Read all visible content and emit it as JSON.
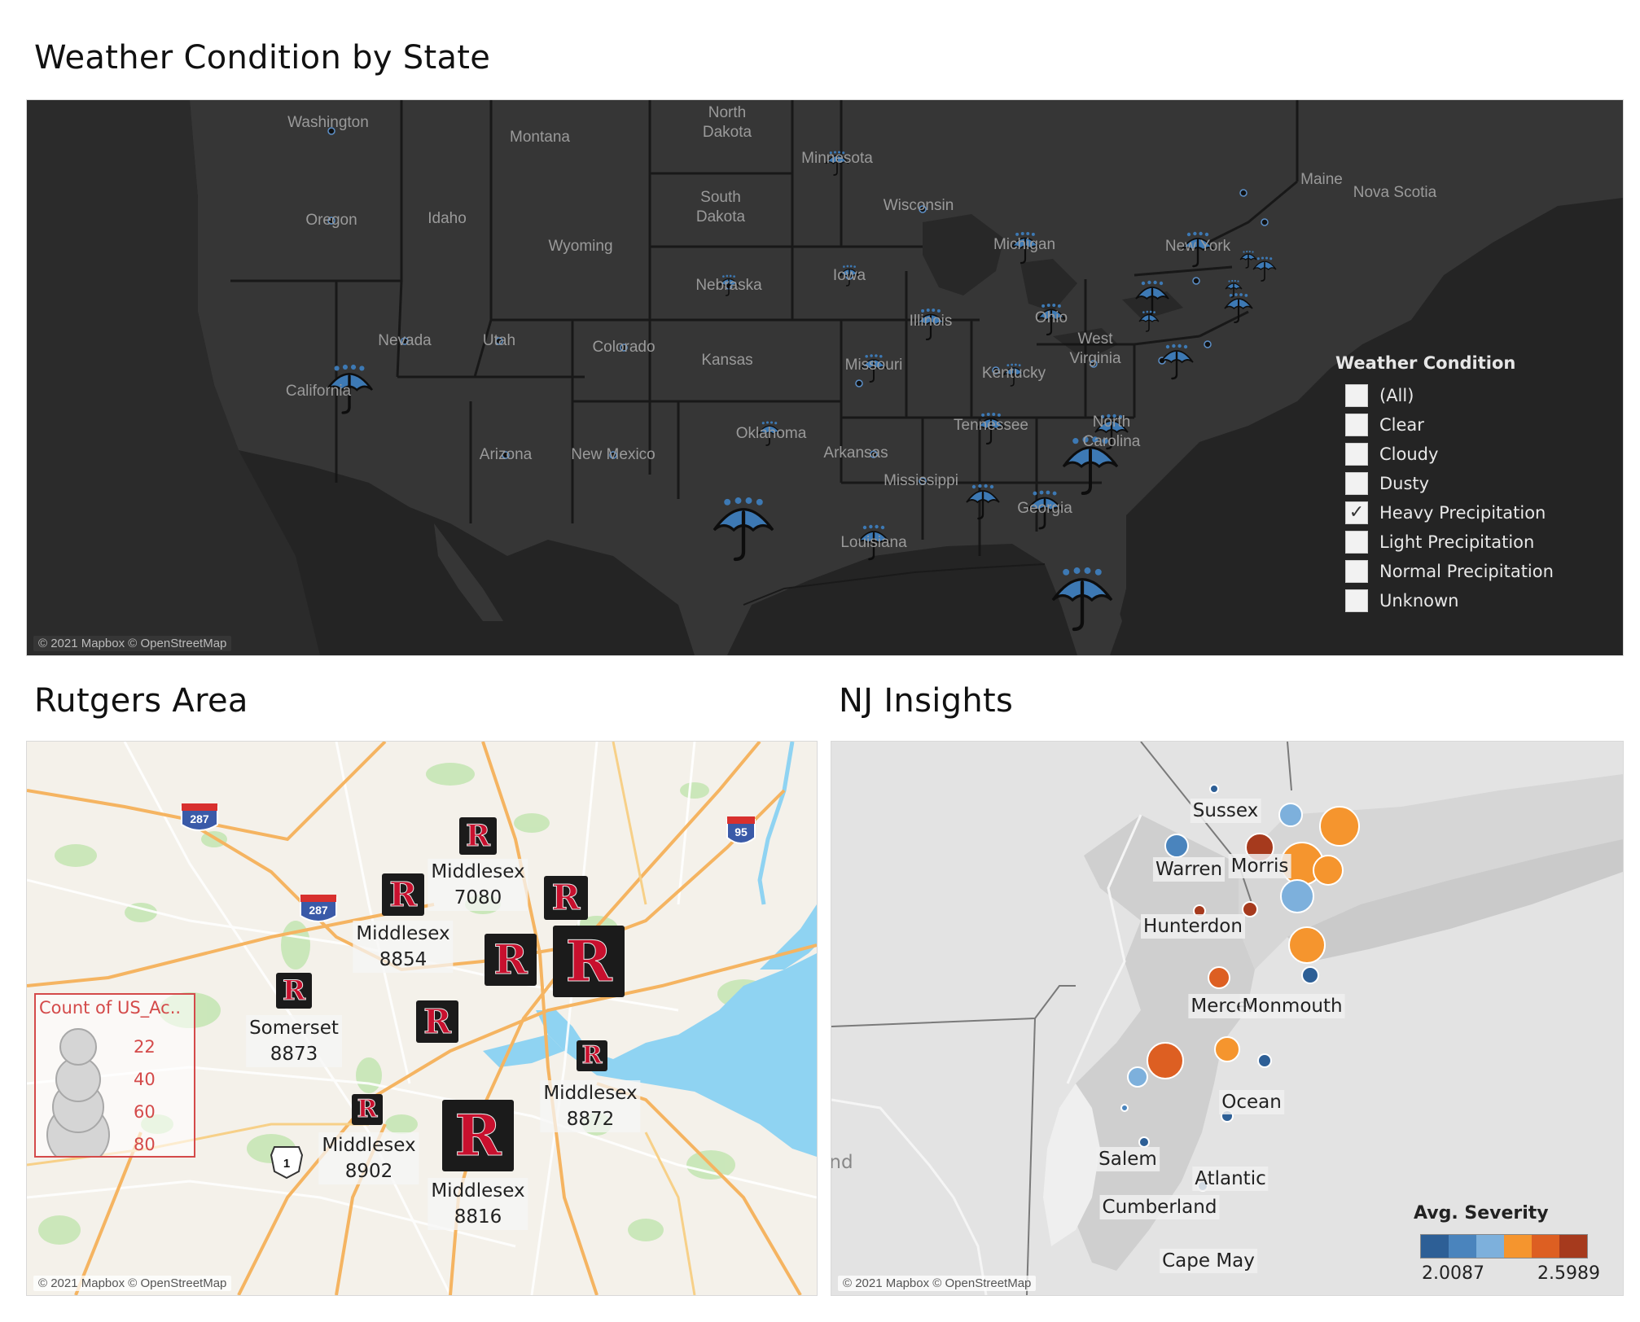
{
  "titles": {
    "weather": "Weather Condition by State",
    "rutgers": "Rutgers Area",
    "nj": "NJ Insights"
  },
  "attribution": "© 2021 Mapbox © OpenStreetMap",
  "us_map": {
    "state_labels": [
      "Washington",
      "Montana",
      "North\nDakota",
      "Minnesota",
      "Maine",
      "Nova Scotia",
      "Oregon",
      "Idaho",
      "South\nDakota",
      "Wisconsin",
      "Wyoming",
      "Michigan",
      "New York",
      "Nebraska",
      "Iowa",
      "Nevada",
      "Utah",
      "Colorado",
      "Illinois",
      "Ohio",
      "Kansas",
      "Missouri",
      "West\nVirginia",
      "Kentucky",
      "California",
      "Oklahoma",
      "Tennessee",
      "North\nCarolina",
      "Arkansas",
      "Arizona",
      "New Mexico",
      "Mississippi",
      "Georgia",
      "Louisiana"
    ],
    "umbrella_icon": "umbrella-rain-icon"
  },
  "weather_filter": {
    "title": "Weather Condition",
    "options": [
      "(All)",
      "Clear",
      "Cloudy",
      "Dusty",
      "Heavy Precipitation",
      "Light Precipitation",
      "Normal Precipitation",
      "Unknown"
    ],
    "checked": [
      "Heavy Precipitation"
    ]
  },
  "rutgers": {
    "markers": [
      {
        "county": "Middlesex",
        "zip": "7080"
      },
      {
        "county": "Middlesex",
        "zip": "8854"
      },
      {
        "county": "Somerset",
        "zip": "8873"
      },
      {
        "county": "Middlesex",
        "zip": "8872"
      },
      {
        "county": "Middlesex",
        "zip": "8902"
      },
      {
        "county": "Middlesex",
        "zip": "8816"
      }
    ],
    "mark_letter": "R",
    "highway_shields": [
      "287",
      "287",
      "95",
      "1"
    ],
    "size_legend": {
      "title": "Count of US_Ac..",
      "values": [
        "22",
        "40",
        "60",
        "80"
      ]
    }
  },
  "nj": {
    "counties": [
      "Sussex",
      "Warren",
      "Morris",
      "Hunterdon",
      "Mercer",
      "Monmouth",
      "Ocean",
      "Salem",
      "Atlantic",
      "Cumberland",
      "Cape May"
    ],
    "partial_label": "nd",
    "severity": {
      "title": "Avg. Severity",
      "min": "2.0087",
      "max": "2.5989",
      "colors": [
        "#2d5f96",
        "#4a84bd",
        "#7db0dc",
        "#f5952e",
        "#dd5f22",
        "#a63a1d"
      ]
    }
  }
}
